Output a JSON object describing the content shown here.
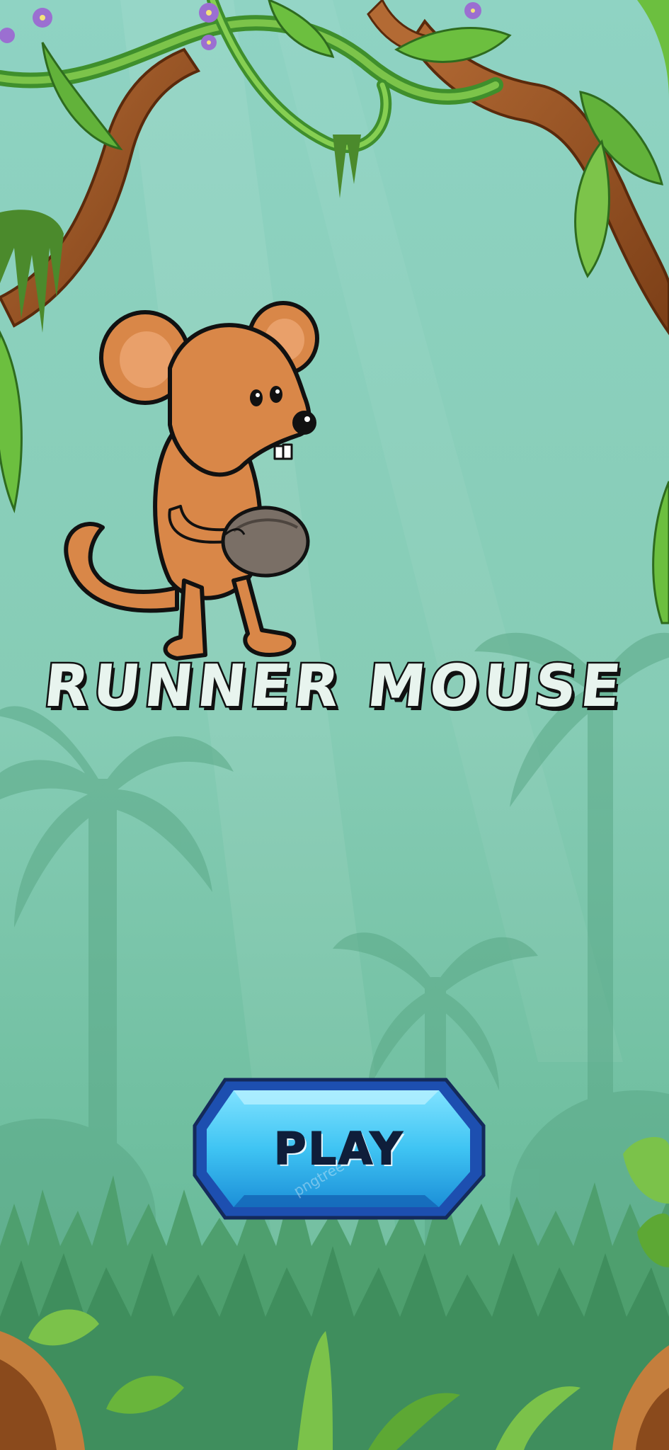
{
  "game": {
    "title": "RUNNER MOUSE",
    "play_label": "PLAY",
    "watermark": "pngtree"
  },
  "colors": {
    "bg_top": "#94d7c6",
    "bg_bottom": "#5eb694",
    "button_fill": "#3ec3f2",
    "button_edge": "#1d4fb0",
    "mouse_fur": "#c9773b",
    "title_fill": "#e8f4ee"
  },
  "icons": [
    "mouse-character",
    "acorn",
    "jungle-vines",
    "palm-silhouettes",
    "grass"
  ]
}
